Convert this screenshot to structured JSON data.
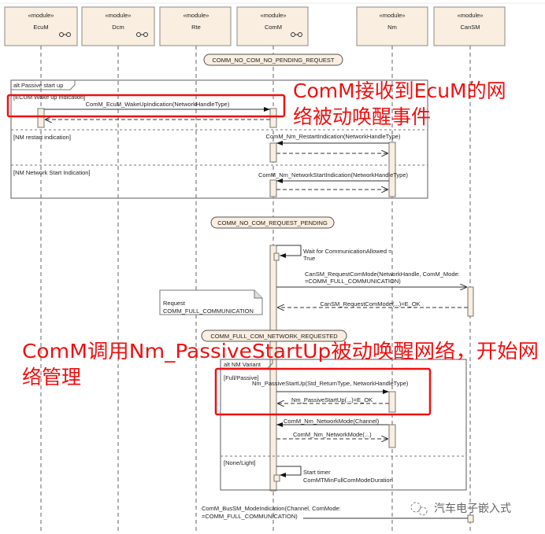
{
  "lifelines": [
    {
      "stereotype": "«module»",
      "name": "EcuM",
      "component_icon": true
    },
    {
      "stereotype": "«module»",
      "name": "Dcm",
      "component_icon": true
    },
    {
      "stereotype": "«module»",
      "name": "Rte",
      "component_icon": false
    },
    {
      "stereotype": "«module»",
      "name": "ComM",
      "component_icon": true
    },
    {
      "stereotype": "«module»",
      "name": "Nm",
      "component_icon": false
    },
    {
      "stereotype": "«module»",
      "name": "CanSM",
      "component_icon": false
    }
  ],
  "states": [
    "COMM_NO_COM_NO_PENDING_REQUEST",
    "COMM_NO_COM_REQUEST_PENDING",
    "COMM_FULL_COM_NETWORK_REQUESTED"
  ],
  "alt1": {
    "label": "alt Passive start up",
    "guards": [
      "[ECUM Wake up indication]",
      "[NM restart indication]",
      "[NM Network Start Indication]"
    ],
    "messages": [
      "ComM_EcuM_WakeUpIndication(NetworkHandleType)",
      "ComM_Nm_RestartIndication(NetworkHandleType)",
      "ComM_Nm_NetworkStartIndication(NetworkHandleType)"
    ]
  },
  "self1": [
    "Wait for CommunicationAllowed =",
    "True"
  ],
  "cansm_request": [
    "CanSM_RequestComMode(NetworkHandle, ComM_Mode:",
    "=COMM_FULL_COMMUNICATION)"
  ],
  "cansm_return": "CanSM_RequestComMode(...)=E_OK",
  "note": [
    "Request",
    "COMM_FULL_COMMUNICATION"
  ],
  "alt2": {
    "label": "alt NM Variant",
    "guards": [
      "[Full/Passive]",
      "[None/Light]"
    ],
    "passive_call": "Nm_PassiveStartUp(Std_ReturnType, NetworkHandleType)",
    "passive_return": "Nm_PassiveStartUp(...)=E_OK",
    "netmode_call": "ComM_Nm_NetworkMode(Channel)",
    "netmode_return": "ComM_Nm_NetworkMode(...)",
    "timer": [
      "Start timer",
      "ComMTMinFullComModeDuration"
    ]
  },
  "busm": [
    "ComM_BusSM_ModeIndication(Channel, ComMode:",
    "=COMM_FULL_COMMUNICATION)"
  ],
  "annotations": {
    "a1": [
      "ComM接收到EcuM的网",
      "络被动唤醒事件"
    ],
    "a2": [
      "ComM调用Nm_PassiveStartUp被动唤醒网络，开始网",
      "络管理"
    ],
    "color": "#f01010"
  },
  "watermark": "汽车电子嵌入式"
}
